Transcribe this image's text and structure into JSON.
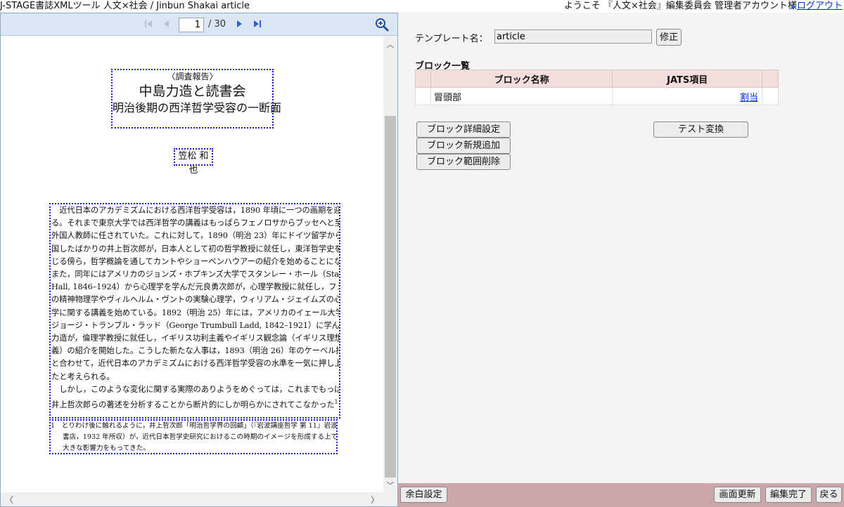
{
  "header": {
    "app_title": "J-STAGE書誌XMLツール  人文×社会 / Jinbun Shakai  article",
    "welcome": "ようこそ 『人文×社会』編集委員会 管理者アカウント様",
    "logout": "ログアウト"
  },
  "viewer": {
    "current_page": "1",
    "total_pages": "/  30",
    "page": {
      "report_label": "〈調査報告〉",
      "title": "中島力造と読書会",
      "subtitle": "明治後期の西洋哲学受容の一断面",
      "author": "笠松 和也",
      "body_lines": [
        "　近代日本のアカデミズムにおける西洋哲学受容は，1890 年頃に一つの画期を迎え",
        "る。それまで東京大学では西洋哲学の講義はもっぱらフェノロサからブッセへと至る",
        "外国人教師に任されていた。これに対して，1890（明治 23）年にドイツ留学から帰",
        "国したばかりの井上哲次郎が，日本人として初の哲学教授に就任し，東洋哲学史を講",
        "じる傍ら，哲学概論を通してカントやショーペンハウアーの紹介を始めることになる。",
        "また，同年にはアメリカのジョンズ・ホプキンズ大学でスタンレー・ホール（Stanley",
        "Hall, 1846–1924）から心理学を学んだ元良勇次郎が，心理学教授に就任し，フェヒナー",
        "の精神物理学やヴィルヘルム・ヴントの実験心理学，ウィリアム・ジェイムズの心理",
        "学に関する講義を始めている。1892（明治 25）年には，アメリカのイェール大学で",
        "ジョージ・トランブル・ラッド（George Trumbull Ladd, 1842–1921）に学んだ中島",
        "力造が，倫理学教授に就任し，イギリス功利主義やイギリス観念論（イギリス理想主",
        "義）の紹介を開始した。こうした新たな人事は，1893（明治 26）年のケーベル招聘",
        "と合わせて，近代日本のアカデミズムにおける西洋哲学受容の水準を一気に押し上げ",
        "たと考えられる。",
        "　しかし，このような変化に関する実際のありようをめぐっては，これまでもっぱら",
        "井上哲次郎らの著述を分析することから断片的にしか明らかにされてこなかった",
        "1 そ"
      ],
      "footnote_lines": [
        "1　とりわけ後に触れるように，井上哲次郎「明治哲学界の回顧」（『岩波講座哲学 第 11』岩波",
        "書店，1932 年所収）が，近代日本哲学史研究におけるこの時期のイメージを形成する上で",
        "大きな影響力をもってきた。"
      ]
    }
  },
  "editor": {
    "template_label": "テンプレート名：",
    "template_value": "article",
    "edit_button": "修正",
    "block_list_heading": "ブロック一覧",
    "table": {
      "headers": [
        "",
        "ブロック名称",
        "JATS項目",
        ""
      ],
      "rows": [
        {
          "name": "冒頭部",
          "jats": "",
          "action": "割当"
        }
      ]
    },
    "buttons": {
      "block_detail": "ブロック詳細設定",
      "block_new": "ブロック新規追加",
      "block_delete": "ブロック範囲削除",
      "test_convert": "テスト変換"
    }
  },
  "footer": {
    "margin_settings": "余白設定",
    "refresh": "画面更新",
    "finish_edit": "編集完了",
    "back": "戻る"
  },
  "colors": {
    "pager_bg": "#dbe6f5",
    "footer_bg": "#c9a7aa",
    "table_header_bg": "#f3dedd",
    "dotted_border": "#1a1ad6",
    "link": "#0033cc"
  }
}
